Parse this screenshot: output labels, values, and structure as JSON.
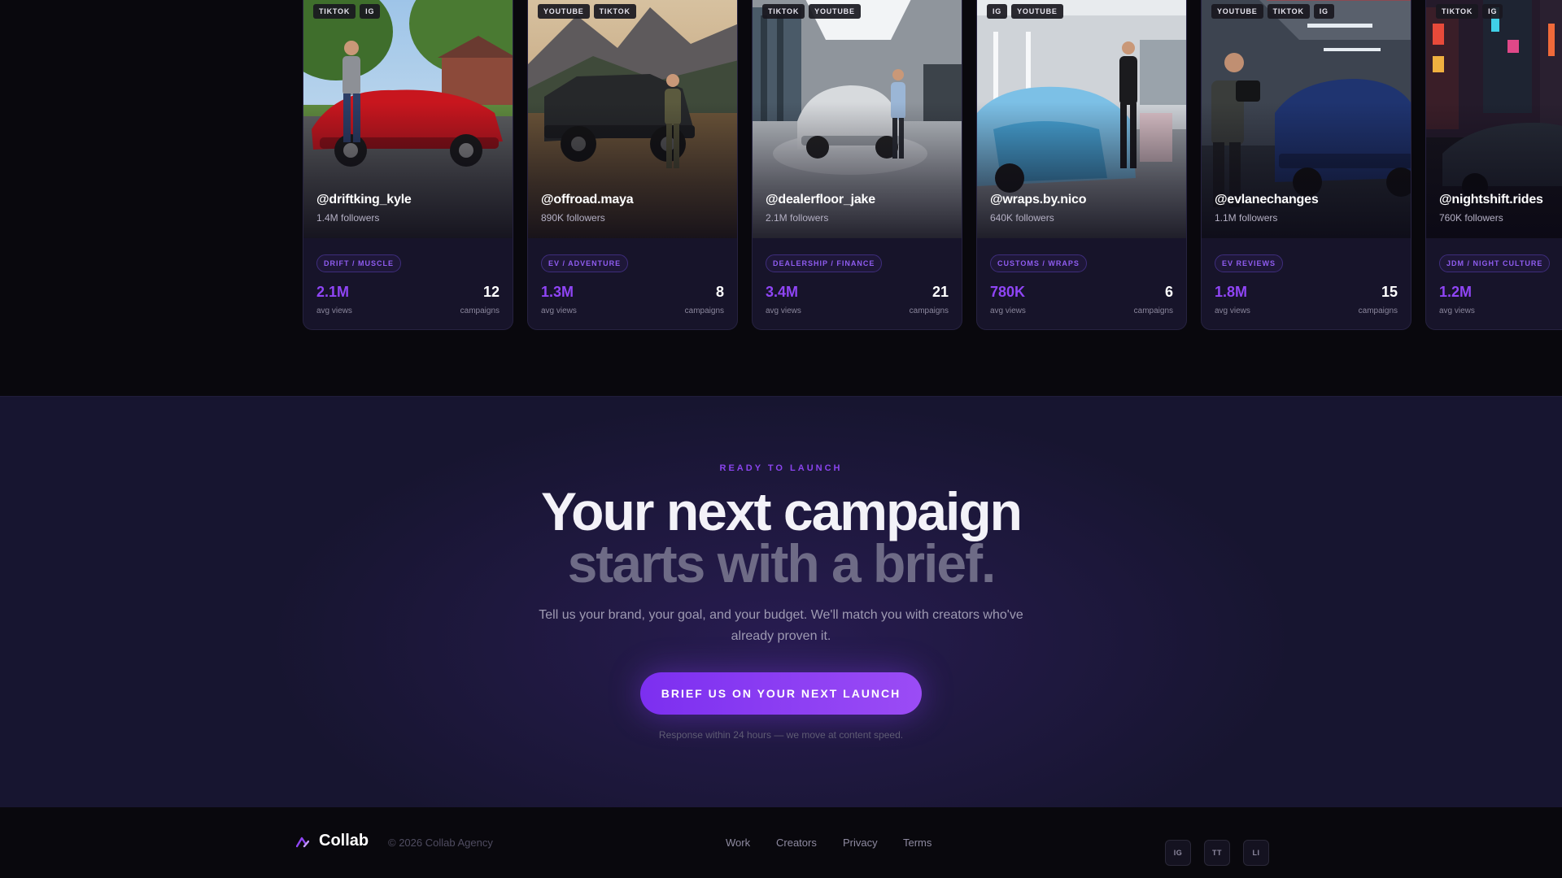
{
  "creators": [
    {
      "platforms": [
        "TIKTOK",
        "IG"
      ],
      "handle": "@driftking_kyle",
      "followers": "1.4M followers",
      "niche": "DRIFT / MUSCLE",
      "views": "2.1M",
      "views_label": "avg views",
      "campaigns": "12",
      "campaigns_label": "campaigns"
    },
    {
      "platforms": [
        "YOUTUBE",
        "TIKTOK"
      ],
      "handle": "@offroad.maya",
      "followers": "890K followers",
      "niche": "EV / ADVENTURE",
      "views": "1.3M",
      "views_label": "avg views",
      "campaigns": "8",
      "campaigns_label": "campaigns"
    },
    {
      "platforms": [
        "TIKTOK",
        "YOUTUBE"
      ],
      "handle": "@dealerfloor_jake",
      "followers": "2.1M followers",
      "niche": "DEALERSHIP / FINANCE",
      "views": "3.4M",
      "views_label": "avg views",
      "campaigns": "21",
      "campaigns_label": "campaigns"
    },
    {
      "platforms": [
        "IG",
        "YOUTUBE"
      ],
      "handle": "@wraps.by.nico",
      "followers": "640K followers",
      "niche": "CUSTOMS / WRAPS",
      "views": "780K",
      "views_label": "avg views",
      "campaigns": "6",
      "campaigns_label": "campaigns"
    },
    {
      "platforms": [
        "YOUTUBE",
        "TIKTOK",
        "IG"
      ],
      "handle": "@evlanechanges",
      "followers": "1.1M followers",
      "niche": "EV REVIEWS",
      "views": "1.8M",
      "views_label": "avg views",
      "campaigns": "15",
      "campaigns_label": "campaigns"
    },
    {
      "platforms": [
        "TIKTOK",
        "IG"
      ],
      "handle": "@nightshift.rides",
      "followers": "760K followers",
      "niche": "JDM / NIGHT CULTURE",
      "views": "1.2M",
      "views_label": "avg views",
      "campaigns": "",
      "campaigns_label": ""
    }
  ],
  "cta": {
    "eyebrow": "READY TO LAUNCH",
    "headline_line1": "Your next campaign",
    "headline_line2": "starts with a brief.",
    "subcopy": "Tell us your brand, your goal, and your budget. We'll match you with creators who've already proven it.",
    "button_label": "BRIEF US ON YOUR NEXT LAUNCH",
    "response_note": "Response within 24 hours — we move at content speed."
  },
  "footer": {
    "brand": "Collab",
    "copyright": "© 2026 Collab Agency",
    "nav": [
      "Work",
      "Creators",
      "Privacy",
      "Terms"
    ],
    "social": [
      "IG",
      "TT",
      "LI"
    ]
  },
  "colors": {
    "accent": "#8f45f5",
    "background": "#09080d",
    "cta_background": "#171530"
  }
}
